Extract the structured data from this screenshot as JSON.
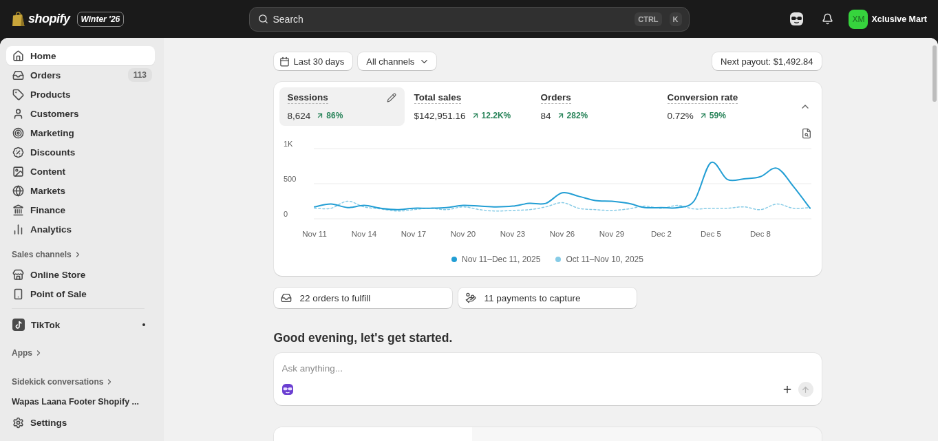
{
  "top_bar": {
    "logo_text": "shopify",
    "edition_badge": "Winter '26",
    "search": {
      "placeholder": "Search",
      "shortcut": [
        "CTRL",
        "K"
      ]
    },
    "store": {
      "initials": "XM",
      "name": "Xclusive Mart"
    }
  },
  "sidebar": {
    "items": [
      {
        "label": "Home",
        "selected": true
      },
      {
        "label": "Orders",
        "selected": false,
        "badge": "113"
      },
      {
        "label": "Products",
        "selected": false
      },
      {
        "label": "Customers",
        "selected": false
      },
      {
        "label": "Marketing",
        "selected": false
      },
      {
        "label": "Discounts",
        "selected": false
      },
      {
        "label": "Content",
        "selected": false
      },
      {
        "label": "Markets",
        "selected": false
      },
      {
        "label": "Finance",
        "selected": false
      },
      {
        "label": "Analytics",
        "selected": false
      }
    ],
    "sales_channels": {
      "title": "Sales channels",
      "items": [
        {
          "label": "Online Store",
          "selected": false
        },
        {
          "label": "Point of Sale",
          "selected": false
        }
      ]
    },
    "pinned_apps": [
      {
        "label": "TikTok",
        "selected": false,
        "indicator": true
      }
    ],
    "apps": {
      "title": "Apps"
    },
    "sidekick_conversations": {
      "title": "Sidekick conversations",
      "items": [
        {
          "label": "Wapas Laana Footer Shopify ...",
          "selected": false
        }
      ]
    },
    "settings": {
      "label": "Settings",
      "selected": false
    }
  },
  "main": {
    "filters": [
      {
        "kind": "date",
        "label": "Last 30 days"
      },
      {
        "kind": "dropdown",
        "label": "All channels"
      }
    ],
    "payout": "Next payout: $1,492.84",
    "metrics": [
      {
        "label": "Sessions",
        "value": "8,624",
        "change": "86%",
        "selected": true
      },
      {
        "label": "Total sales",
        "value": "$142,951.16",
        "change": "12.2K%",
        "selected": false
      },
      {
        "label": "Orders",
        "value": "84",
        "change": "282%",
        "selected": false
      },
      {
        "label": "Conversion rate",
        "value": "0.72%",
        "change": "59%",
        "selected": false
      }
    ],
    "chart_data": {
      "type": "line",
      "categories": [
        "Nov 11",
        null,
        null,
        "Nov 14",
        null,
        null,
        "Nov 17",
        null,
        null,
        "Nov 20",
        null,
        null,
        "Nov 23",
        null,
        null,
        "Nov 26",
        null,
        null,
        "Nov 29",
        null,
        null,
        "Dec 2",
        null,
        null,
        "Dec 5",
        null,
        null,
        "Dec 8",
        null,
        null,
        null
      ],
      "yticks": [
        0,
        500,
        {
          "value": 1000,
          "label": "1K"
        }
      ],
      "ylim": [
        0,
        1000
      ],
      "series": [
        {
          "name": "Nov 11–Dec 11, 2025",
          "color": "#229ed4",
          "line_style": "solid",
          "values": [
            170,
            210,
            160,
            190,
            150,
            130,
            150,
            150,
            160,
            190,
            180,
            170,
            180,
            220,
            220,
            370,
            320,
            260,
            250,
            220,
            160,
            160,
            160,
            260,
            800,
            560,
            570,
            600,
            720,
            460,
            150
          ]
        },
        {
          "name": "Oct 11–Nov 10, 2025",
          "color": "#86cbe6",
          "line_style": "dashed",
          "values": [
            150,
            150,
            250,
            170,
            140,
            110,
            130,
            150,
            130,
            170,
            130,
            110,
            120,
            130,
            170,
            230,
            150,
            130,
            120,
            140,
            180,
            150,
            190,
            140,
            150,
            150,
            170,
            130,
            210,
            150,
            160
          ]
        }
      ]
    },
    "tasks": [
      {
        "label": "22 orders to fulfill"
      },
      {
        "label": "11 payments to capture"
      }
    ],
    "greeting": "Good evening, let's get started.",
    "ask": {
      "placeholder": "Ask anything..."
    }
  }
}
